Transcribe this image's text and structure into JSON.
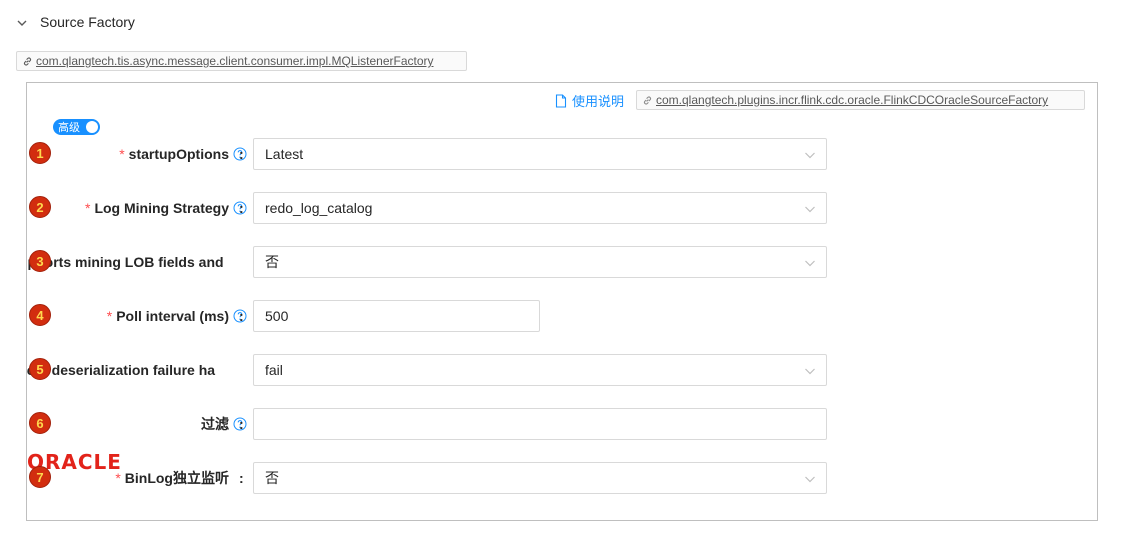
{
  "section": {
    "title": "Source Factory",
    "toggle_icon": "chevron-down-icon"
  },
  "outer_tag": {
    "text": "com.qlangtech.tis.async.message.client.consumer.impl.MQListenerFactory",
    "icon": "link-icon"
  },
  "panel": {
    "help_link": {
      "text": "使用说明",
      "icon": "document-icon"
    },
    "impl_tag": {
      "text": "com.qlangtech.plugins.incr.flink.cdc.oracle.FlinkCDCOracleSourceFactory",
      "icon": "link-icon"
    },
    "advanced_toggle": {
      "label": "高级",
      "on": true
    },
    "brand_logo": {
      "text": "ORACLE",
      "color": "#e2231a"
    }
  },
  "colors": {
    "accent": "#1890ff",
    "required": "#ff4d4f",
    "badge": "#d22d0f",
    "badge_text": "#ffd84d"
  },
  "fields": [
    {
      "num": "1",
      "label": "startupOptions",
      "required": true,
      "help": true,
      "control": "select",
      "value": "Latest"
    },
    {
      "num": "2",
      "label": "Log Mining Strategy",
      "required": true,
      "help": true,
      "control": "select",
      "value": "redo_log_catalog"
    },
    {
      "num": "3",
      "label": "upports mining LOB fields and",
      "required": false,
      "help": false,
      "control": "select",
      "value": "否"
    },
    {
      "num": "4",
      "label": "Poll interval (ms)",
      "required": true,
      "help": true,
      "control": "input",
      "value": "500"
    },
    {
      "num": "5",
      "label": "vent deserialization failure ha",
      "required": false,
      "help": false,
      "control": "select",
      "value": "fail"
    },
    {
      "num": "6",
      "label": "过滤",
      "required": false,
      "help": true,
      "control": "text",
      "value": ""
    },
    {
      "num": "7",
      "label": "BinLog独立监听",
      "required": true,
      "help": false,
      "control": "select",
      "value": "否"
    }
  ],
  "colon": ":"
}
